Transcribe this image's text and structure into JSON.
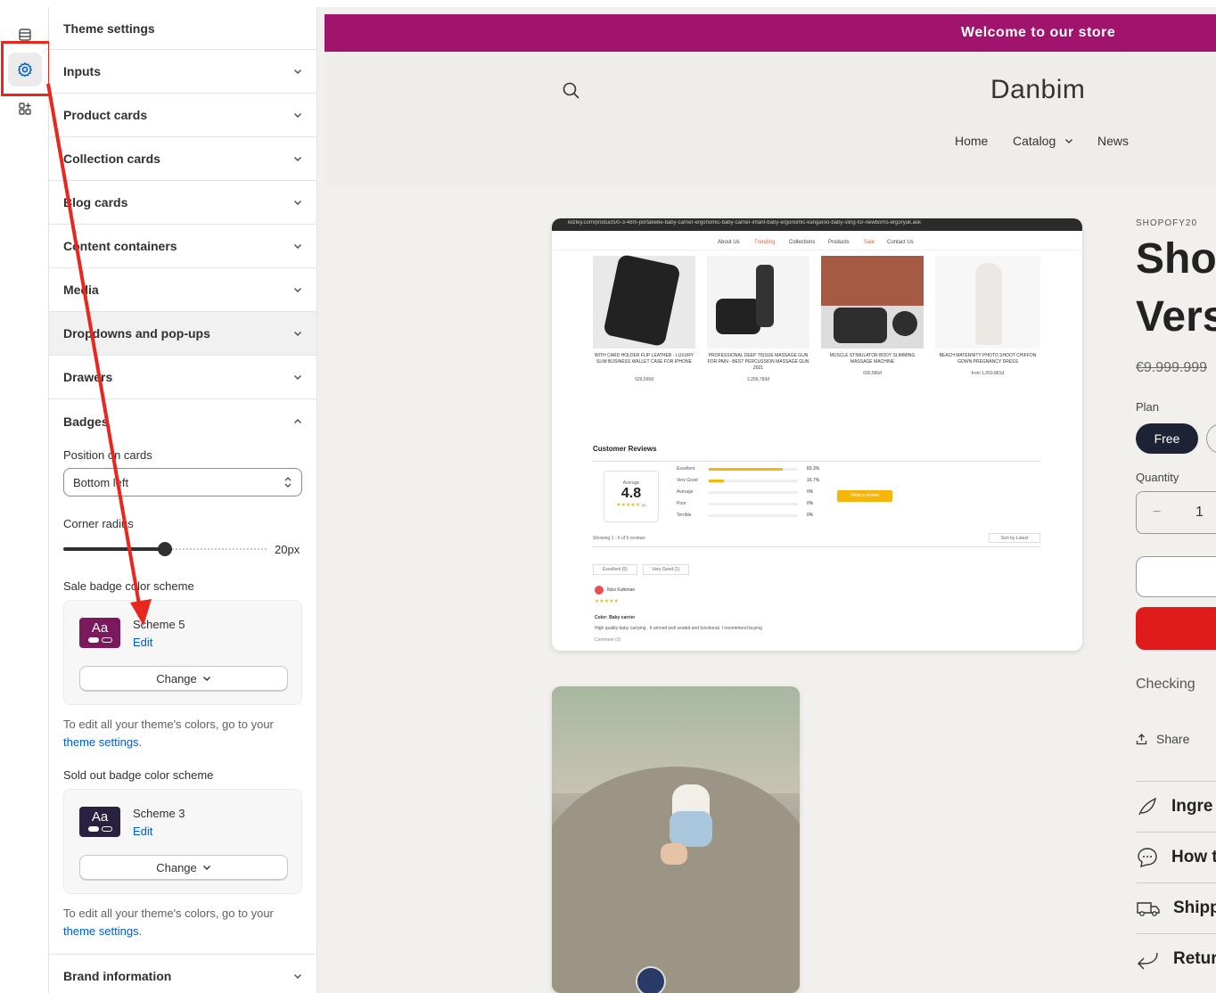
{
  "rail": {
    "icons": [
      "sections-icon",
      "settings-gear-icon",
      "app-blocks-icon"
    ]
  },
  "panel": {
    "title": "Theme settings",
    "sections_before": [
      {
        "label": "Inputs"
      },
      {
        "label": "Product cards"
      },
      {
        "label": "Collection cards"
      },
      {
        "label": "Blog cards"
      },
      {
        "label": "Content containers"
      },
      {
        "label": "Media"
      },
      {
        "label": "Dropdowns and pop-ups"
      },
      {
        "label": "Drawers"
      }
    ],
    "badges": {
      "label": "Badges",
      "position_label": "Position on cards",
      "position_value": "Bottom left",
      "corner_label": "Corner radius",
      "corner_value": "20px",
      "corner_fraction": 0.5,
      "sale": {
        "label": "Sale badge color scheme",
        "swatch_text": "Aa",
        "swatch_color": "#7a1a5c",
        "name": "Scheme 5",
        "edit": "Edit",
        "change": "Change"
      },
      "help1": {
        "text": "To edit all your theme's colors, go to your ",
        "link": "theme settings",
        "suffix": "."
      },
      "soldout": {
        "label": "Sold out badge color scheme",
        "swatch_text": "Aa",
        "swatch_color": "#2a2140",
        "name": "Scheme 3",
        "edit": "Edit",
        "change": "Change"
      },
      "help2": {
        "text": "To edit all your theme's colors, go to your ",
        "link": "theme settings",
        "suffix": "."
      }
    },
    "sections_after": [
      {
        "label": "Brand information"
      }
    ]
  },
  "preview": {
    "announcement": "Welcome to our store",
    "brand": "Danbim",
    "nav": {
      "home": "Home",
      "catalog": "Catalog",
      "news": "News"
    },
    "vendor": "SHOPOFY20",
    "title_line1": "Sho",
    "title_line2": "Vers",
    "price": "€9.999.999",
    "plan_label": "Plan",
    "plan_value": "Free",
    "qty_label": "Quantity",
    "qty_minus": "−",
    "qty_value": "1",
    "checking": "Checking",
    "share": "Share",
    "accordions": [
      "Ingre",
      "How t",
      "Shipp",
      "Retur"
    ],
    "screenshot": {
      "url": "kilzley.com/products/0-3-48m-portabebe-baby-carrier-ergonomic-baby-carrier-infant-baby-ergonomic-kangaroo-baby-sling-for-newborns-ergoryuk.ask",
      "nav": [
        "About Us",
        "Trending",
        "Collections",
        "Products",
        "Sale",
        "Contact Us"
      ],
      "products": [
        "WITH CARD HOLDER FLIP LEATHER - LUXURY SLIM BUSINESS WALLET CASE FOR IPHONE",
        "PROFESSIONAL DEEP TISSUE MASSAGE GUN FOR PAIN - BEST PERCUSSION MASSAGE GUN 2021",
        "MUSCLE STIMULATOR BODY SLIMMING MASSAGE MACHINE",
        "BEACH MATERNITY PHOTO SHOOT CHIFFON GOWN PREGNANCY DRESS"
      ],
      "prices": [
        "529,595đ",
        "2,258,789đ",
        "690,986đ",
        "from 1,059,881đ"
      ],
      "reviews_title": "Customer Reviews",
      "average_label": "Average",
      "average": "4.8",
      "review_count": "(6)",
      "rows": [
        {
          "label": "Excellent",
          "pct": "83.3%",
          "fraction": 0.833
        },
        {
          "label": "Very Good",
          "pct": "16.7%",
          "fraction": 0.167
        },
        {
          "label": "Average",
          "pct": "0%",
          "fraction": 0
        },
        {
          "label": "Poor",
          "pct": "0%",
          "fraction": 0
        },
        {
          "label": "Terrible",
          "pct": "0%",
          "fraction": 0
        }
      ],
      "write_review": "Write a review",
      "showing": "Showing 1 - 6 of 6 reviews",
      "sort": "Sort by Latest",
      "filters": [
        "Excellent (5)",
        "Very Good (1)"
      ],
      "reviewer": "Nico Kuhiman",
      "variant": "Color: Baby carrier",
      "review_text": "High quality baby carrying . It arrived well sealed and functional. I recommend buying",
      "comment": "Comment (0)"
    }
  },
  "colors": {
    "accent": "#e8281e",
    "link": "#005bd3",
    "announcement": "#a0146e",
    "buy": "#e01b1b"
  }
}
